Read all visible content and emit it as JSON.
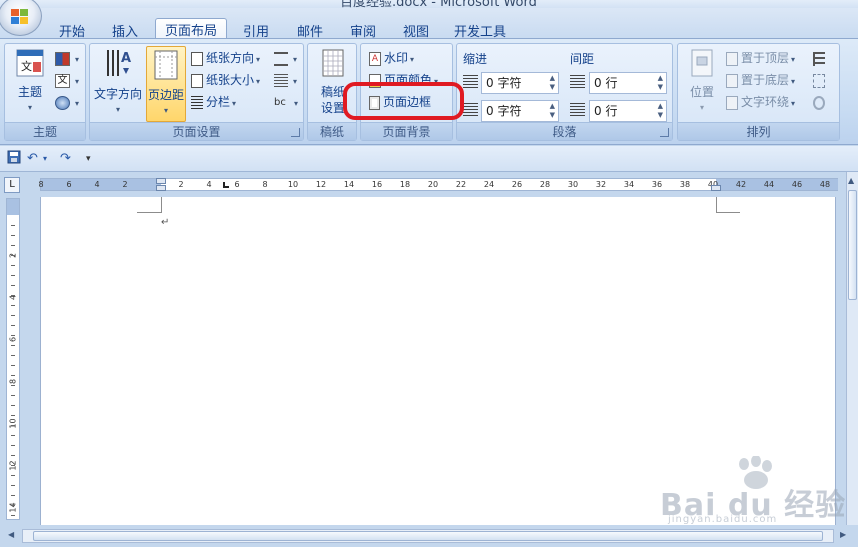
{
  "window": {
    "title": "百度经验.docx - Microsoft Word"
  },
  "tabs": [
    {
      "label": "开始"
    },
    {
      "label": "插入"
    },
    {
      "label": "页面布局"
    },
    {
      "label": "引用"
    },
    {
      "label": "邮件"
    },
    {
      "label": "审阅"
    },
    {
      "label": "视图"
    },
    {
      "label": "开发工具"
    }
  ],
  "ribbon": {
    "theme_group": {
      "label": "主题",
      "theme_button": "主题"
    },
    "page_setup_group": {
      "label": "页面设置",
      "text_direction": "文字方向",
      "margins": "页边距",
      "orientation": "纸张方向",
      "size": "纸张大小",
      "columns": "分栏"
    },
    "draft_group": {
      "label": "稿纸",
      "button_line1": "稿纸",
      "button_line2": "设置"
    },
    "page_background_group": {
      "label": "页面背景",
      "watermark": "水印",
      "page_color": "页面颜色",
      "page_borders": "页面边框"
    },
    "paragraph_group": {
      "label": "段落",
      "indent_label": "缩进",
      "spacing_label": "间距",
      "indent_left": "0 字符",
      "indent_right": "0 字符",
      "spacing_before": "0 行",
      "spacing_after": "0 行"
    },
    "arrange_group": {
      "label": "排列",
      "position": "位置",
      "bring_front": "置于顶层",
      "send_back": "置于底层",
      "text_wrap": "文字环绕"
    }
  },
  "ruler": {
    "h_numbers": [
      "8",
      "6",
      "4",
      "2",
      "2",
      "4",
      "6",
      "8",
      "10",
      "12",
      "14",
      "16",
      "18",
      "20",
      "22",
      "24",
      "26",
      "28",
      "30",
      "32",
      "34",
      "36",
      "38",
      "40",
      "42",
      "44",
      "46",
      "48"
    ],
    "v_numbers": [
      "2",
      "4",
      "6",
      "8",
      "10",
      "12",
      "14"
    ]
  },
  "document": {
    "paragraph_mark": "↵"
  },
  "watermark": {
    "brand": "Bai du 经验",
    "url": "jingyan.baidu.com"
  },
  "colors": {
    "accent": "#15428b",
    "highlight": "#e01a22",
    "ribbon": "#c7dbf2"
  }
}
